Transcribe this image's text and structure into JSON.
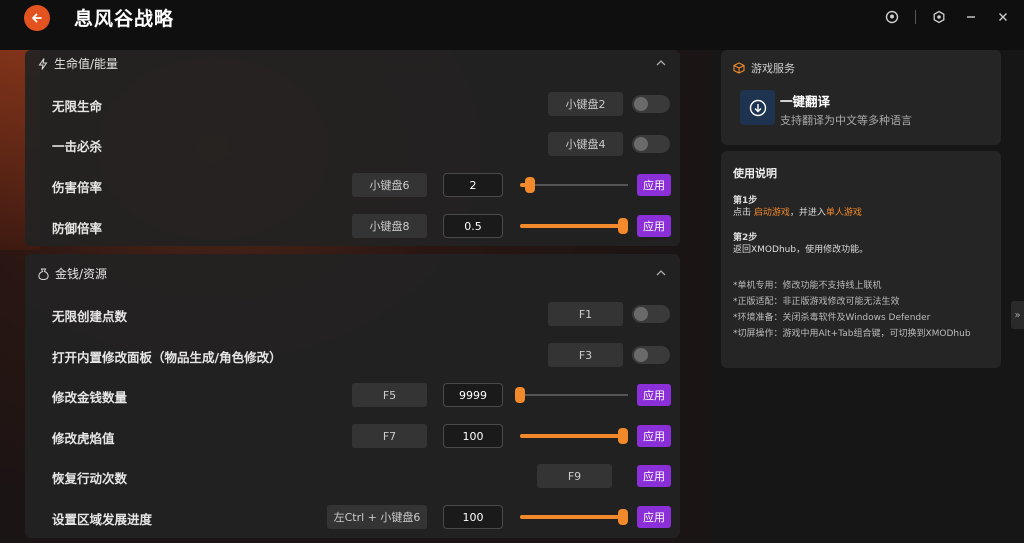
{
  "app": {
    "title": "息风谷战略"
  },
  "sections": [
    {
      "title": "生命值/能量",
      "rows": [
        {
          "label": "无限生命",
          "key": "小键盘2",
          "control": "toggle"
        },
        {
          "label": "一击必杀",
          "key": "小键盘4",
          "control": "toggle"
        },
        {
          "label": "伤害倍率",
          "key": "小键盘6",
          "value": "2",
          "level": 0.05,
          "apply": "应用"
        },
        {
          "label": "防御倍率",
          "key": "小键盘8",
          "value": "0.5",
          "level": 1.0,
          "apply": "应用"
        }
      ]
    },
    {
      "title": "金钱/资源",
      "rows": [
        {
          "label": "无限创建点数",
          "key": "F1",
          "control": "toggle"
        },
        {
          "label": "打开内置修改面板（物品生成/角色修改）",
          "key": "F3",
          "control": "toggle"
        },
        {
          "label": "修改金钱数量",
          "key": "F5",
          "value": "9999",
          "level": 0.0,
          "apply": "应用"
        },
        {
          "label": "修改虎焰值",
          "key": "F7",
          "value": "100",
          "level": 1.0,
          "apply": "应用"
        },
        {
          "label": "恢复行动次数",
          "key": "F9",
          "apply": "应用"
        },
        {
          "label": "设置区域发展进度",
          "key": "左Ctrl + 小键盘6",
          "value": "100",
          "level": 1.0,
          "apply": "应用"
        }
      ]
    }
  ],
  "service": {
    "header": "游戏服务",
    "title": "一键翻译",
    "desc": "支持翻译为中文等多种语言"
  },
  "guide": {
    "title": "使用说明",
    "step1_title": "第1步",
    "step1_a": "点击 ",
    "step1_link1": "启动游戏",
    "step1_b": "，并进入",
    "step1_link2": "单人游戏",
    "step2_title": "第2步",
    "step2_text": "返回XMODhub，使用修改功能。",
    "notes": [
      "*单机专用：修改功能不支持线上联机",
      "*正版适配：非正版游戏修改可能无法生效",
      "*环境准备：关闭杀毒软件及Windows Defender",
      "*切屏操作：游戏中用Alt+Tab组合键，可切换到XMODhub"
    ]
  },
  "colors": {
    "accent": "#f2892a",
    "apply": "#8b2fd9",
    "back": "#e2531f",
    "tile": "#1d3350"
  }
}
